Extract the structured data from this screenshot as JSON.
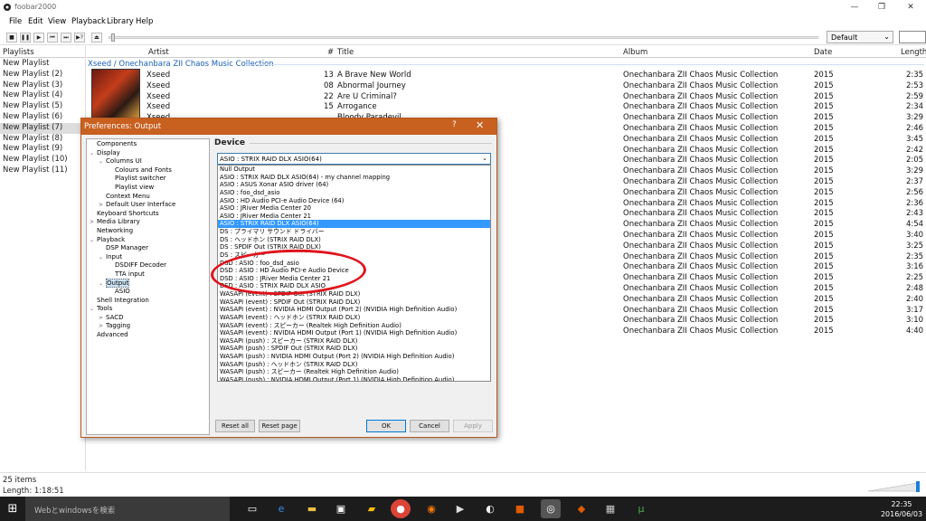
{
  "window": {
    "title": "foobar2000",
    "min": "—",
    "max": "❐",
    "close": "✕"
  },
  "menu": [
    "File",
    "Edit",
    "View",
    "Playback",
    "Library",
    "Help"
  ],
  "toolbar": {
    "buttons": [
      "■",
      "❚❚",
      "▶",
      "⏮",
      "⏭",
      "▶?",
      "⏏"
    ],
    "order_combo": "Default"
  },
  "playlists": {
    "header": "Playlists",
    "items": [
      "New Playlist",
      "New Playlist (2)",
      "New Playlist (3)",
      "New Playlist (4)",
      "New Playlist (5)",
      "New Playlist (6)",
      "New Playlist (7)",
      "New Playlist (8)",
      "New Playlist (9)",
      "New Playlist (10)",
      "New Playlist (11)"
    ],
    "selected_index": 6
  },
  "columns": {
    "artist": "Artist",
    "num": "#",
    "title": "Title",
    "album": "Album",
    "date": "Date",
    "length": "Length"
  },
  "group_header": "Xseed / Onechanbara ZII Chaos Music Collection",
  "tracks": [
    {
      "artist": "Xseed",
      "num": "13",
      "title": "A Brave New World",
      "album": "Onechanbara ZII Chaos Music Collection",
      "date": "2015",
      "length": "2:35"
    },
    {
      "artist": "Xseed",
      "num": "08",
      "title": "Abnormal Journey",
      "album": "Onechanbara ZII Chaos Music Collection",
      "date": "2015",
      "length": "2:53"
    },
    {
      "artist": "Xseed",
      "num": "22",
      "title": "Are U Criminal?",
      "album": "Onechanbara ZII Chaos Music Collection",
      "date": "2015",
      "length": "2:59"
    },
    {
      "artist": "Xseed",
      "num": "15",
      "title": "Arrogance",
      "album": "Onechanbara ZII Chaos Music Collection",
      "date": "2015",
      "length": "2:34"
    },
    {
      "artist": "Xseed",
      "num": "",
      "title": "Bloody Paradevil",
      "album": "Onechanbara ZII Chaos Music Collection",
      "date": "2015",
      "length": "3:29"
    },
    {
      "artist": "",
      "num": "",
      "title": "",
      "album": "Onechanbara ZII Chaos Music Collection",
      "date": "2015",
      "length": "2:46"
    },
    {
      "artist": "",
      "num": "",
      "title": "",
      "album": "Onechanbara ZII Chaos Music Collection",
      "date": "2015",
      "length": "3:45"
    },
    {
      "artist": "",
      "num": "",
      "title": "",
      "album": "Onechanbara ZII Chaos Music Collection",
      "date": "2015",
      "length": "2:42"
    },
    {
      "artist": "",
      "num": "",
      "title": "",
      "album": "Onechanbara ZII Chaos Music Collection",
      "date": "2015",
      "length": "2:05"
    },
    {
      "artist": "",
      "num": "",
      "title": "",
      "album": "Onechanbara ZII Chaos Music Collection",
      "date": "2015",
      "length": "3:29"
    },
    {
      "artist": "",
      "num": "",
      "title": "",
      "album": "Onechanbara ZII Chaos Music Collection",
      "date": "2015",
      "length": "2:37"
    },
    {
      "artist": "",
      "num": "",
      "title": "",
      "album": "Onechanbara ZII Chaos Music Collection",
      "date": "2015",
      "length": "2:56"
    },
    {
      "artist": "",
      "num": "",
      "title": "",
      "album": "Onechanbara ZII Chaos Music Collection",
      "date": "2015",
      "length": "2:36"
    },
    {
      "artist": "",
      "num": "",
      "title": "",
      "album": "Onechanbara ZII Chaos Music Collection",
      "date": "2015",
      "length": "2:43"
    },
    {
      "artist": "",
      "num": "",
      "title": "",
      "album": "Onechanbara ZII Chaos Music Collection",
      "date": "2015",
      "length": "4:54"
    },
    {
      "artist": "",
      "num": "",
      "title": "",
      "album": "Onechanbara ZII Chaos Music Collection",
      "date": "2015",
      "length": "3:40"
    },
    {
      "artist": "",
      "num": "",
      "title": "",
      "album": "Onechanbara ZII Chaos Music Collection",
      "date": "2015",
      "length": "3:25"
    },
    {
      "artist": "",
      "num": "",
      "title": "",
      "album": "Onechanbara ZII Chaos Music Collection",
      "date": "2015",
      "length": "2:35"
    },
    {
      "artist": "",
      "num": "",
      "title": "",
      "album": "Onechanbara ZII Chaos Music Collection",
      "date": "2015",
      "length": "3:16"
    },
    {
      "artist": "",
      "num": "",
      "title": "",
      "album": "Onechanbara ZII Chaos Music Collection",
      "date": "2015",
      "length": "2:25"
    },
    {
      "artist": "",
      "num": "",
      "title": "",
      "album": "Onechanbara ZII Chaos Music Collection",
      "date": "2015",
      "length": "2:48"
    },
    {
      "artist": "",
      "num": "",
      "title": "",
      "album": "Onechanbara ZII Chaos Music Collection",
      "date": "2015",
      "length": "2:40"
    },
    {
      "artist": "",
      "num": "",
      "title": "",
      "album": "Onechanbara ZII Chaos Music Collection",
      "date": "2015",
      "length": "3:17"
    },
    {
      "artist": "",
      "num": "",
      "title": "",
      "album": "Onechanbara ZII Chaos Music Collection",
      "date": "2015",
      "length": "3:10"
    },
    {
      "artist": "",
      "num": "",
      "title": "",
      "album": "Onechanbara ZII Chaos Music Collection",
      "date": "2015",
      "length": "4:40"
    }
  ],
  "status": {
    "items": "25 items",
    "length": "Length: 1:18:51"
  },
  "dialog": {
    "title": "Preferences: Output",
    "help": "?",
    "close": "✕",
    "section": "Device",
    "selected_device": "ASIO : STRIX RAID DLX ASIO(64)",
    "tree": [
      {
        "label": "Components",
        "depth": 0,
        "tw": ""
      },
      {
        "label": "Display",
        "depth": 0,
        "tw": "⌄"
      },
      {
        "label": "Columns UI",
        "depth": 1,
        "tw": "⌄"
      },
      {
        "label": "Colours and Fonts",
        "depth": 2,
        "tw": ""
      },
      {
        "label": "Playlist switcher",
        "depth": 2,
        "tw": ""
      },
      {
        "label": "Playlist view",
        "depth": 2,
        "tw": ""
      },
      {
        "label": "Context Menu",
        "depth": 1,
        "tw": ""
      },
      {
        "label": "Default User Interface",
        "depth": 1,
        "tw": ">"
      },
      {
        "label": "Keyboard Shortcuts",
        "depth": 0,
        "tw": ""
      },
      {
        "label": "Media Library",
        "depth": 0,
        "tw": ">"
      },
      {
        "label": "Networking",
        "depth": 0,
        "tw": ""
      },
      {
        "label": "Playback",
        "depth": 0,
        "tw": "⌄"
      },
      {
        "label": "DSP Manager",
        "depth": 1,
        "tw": ""
      },
      {
        "label": "Input",
        "depth": 1,
        "tw": "⌄"
      },
      {
        "label": "DSDIFF Decoder",
        "depth": 2,
        "tw": ""
      },
      {
        "label": "TTA input",
        "depth": 2,
        "tw": ""
      },
      {
        "label": "Output",
        "depth": 1,
        "tw": "⌄",
        "selected": true
      },
      {
        "label": "ASIO",
        "depth": 2,
        "tw": ""
      },
      {
        "label": "Shell Integration",
        "depth": 0,
        "tw": ""
      },
      {
        "label": "Tools",
        "depth": 0,
        "tw": "⌄"
      },
      {
        "label": "SACD",
        "depth": 1,
        "tw": ">"
      },
      {
        "label": "Tagging",
        "depth": 1,
        "tw": ">"
      },
      {
        "label": "Advanced",
        "depth": 0,
        "tw": ""
      }
    ],
    "devices": [
      "Null Output",
      "ASIO : STRIX RAID DLX ASIO(64) - my channel mapping",
      "ASIO : ASUS Xonar ASIO driver (64)",
      "ASIO : foo_dsd_asio",
      "ASIO : HD Audio PCI-e Audio Device (64)",
      "ASIO : JRiver Media Center 20",
      "ASIO : JRiver Media Center 21",
      "ASIO : STRIX RAID DLX ASIO(64)",
      "DS : プライマリ サウンド ドライバー",
      "DS : ヘッドホン (STRIX RAID DLX)",
      "DS : SPDIF Out (STRIX RAID DLX)",
      "DS : スピーカー",
      "DSD : ASIO : foo_dsd_asio",
      "DSD : ASIO : HD Audio PCI-e Audio Device",
      "DSD : ASIO : JRiver Media Center 21",
      "DSD : ASIO : STRIX RAID DLX ASIO",
      "WASAPI (event) : SPDIF Out (STRIX RAID DLX)",
      "WASAPI (event) : SPDIF Out (STRIX RAID DLX)",
      "WASAPI (event) : NVIDIA HDMI Output (Port 2) (NVIDIA High Definition Audio)",
      "WASAPI (event) : ヘッドホン (STRIX RAID DLX)",
      "WASAPI (event) : スピーカー (Realtek High Definition Audio)",
      "WASAPI (event) : NVIDIA HDMI Output (Port 1) (NVIDIA High Definition Audio)",
      "WASAPI (push) : スピーカー (STRIX RAID DLX)",
      "WASAPI (push) : SPDIF Out (STRIX RAID DLX)",
      "WASAPI (push) : NVIDIA HDMI Output (Port 2) (NVIDIA High Definition Audio)",
      "WASAPI (push) : ヘッドホン (STRIX RAID DLX)",
      "WASAPI (push) : スピーカー (Realtek High Definition Audio)",
      "WASAPI (push) : NVIDIA HDMI Output (Port 1) (NVIDIA High Definition Audio)"
    ],
    "selected_device_index": 7,
    "buttons": {
      "reset_all": "Reset all",
      "reset_page": "Reset page",
      "ok": "OK",
      "cancel": "Cancel",
      "apply": "Apply"
    }
  },
  "taskbar": {
    "search": "Webとwindowsを検索",
    "time": "22:35",
    "date": "2016/06/03"
  },
  "colors": {
    "dialog_title": "#c8601f",
    "selection": "#3399ff",
    "annotation": "#e0141c",
    "group": "#1a5fb4"
  }
}
